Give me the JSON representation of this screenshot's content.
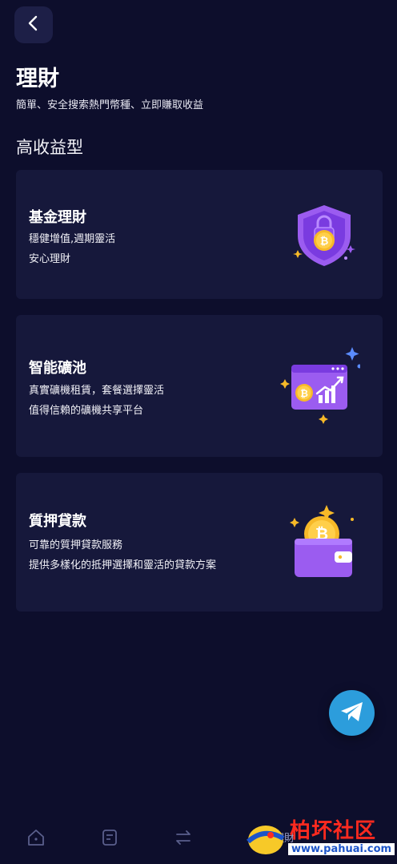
{
  "header": {
    "back_icon": "chevron-left-icon",
    "title": "理財",
    "subtitle": "簡單、安全搜索熱門幣種、立即賺取收益"
  },
  "section": {
    "title": "高收益型"
  },
  "cards": [
    {
      "title": "基金理財",
      "desc": [
        "穩健增值,週期靈活",
        "安心理財"
      ],
      "icon": "bitcoin-shield-icon"
    },
    {
      "title": "智能礦池",
      "desc": [
        "真實礦機租賃，套餐選擇靈活",
        "值得信賴的礦機共享平台"
      ],
      "icon": "mining-chart-icon"
    },
    {
      "title": "質押貸款",
      "desc": [
        "可靠的質押貸款服務",
        "提供多樣化的抵押選擇和靈活的貸款方案"
      ],
      "icon": "bitcoin-wallet-icon"
    }
  ],
  "floating": {
    "icon": "telegram-icon"
  },
  "tabbar": {
    "items": [
      "home-icon",
      "market-icon",
      "trade-icon",
      "finance-icon"
    ],
    "active_label": "理財"
  },
  "watermark": {
    "text": "柏坏社区",
    "url": "www.pahuai.com"
  },
  "colors": {
    "background": "#0d0e2c",
    "card": "#16183b",
    "accent_purple": "#9b5cf0",
    "gold": "#f7b928",
    "telegram": "#2c9ddc"
  }
}
